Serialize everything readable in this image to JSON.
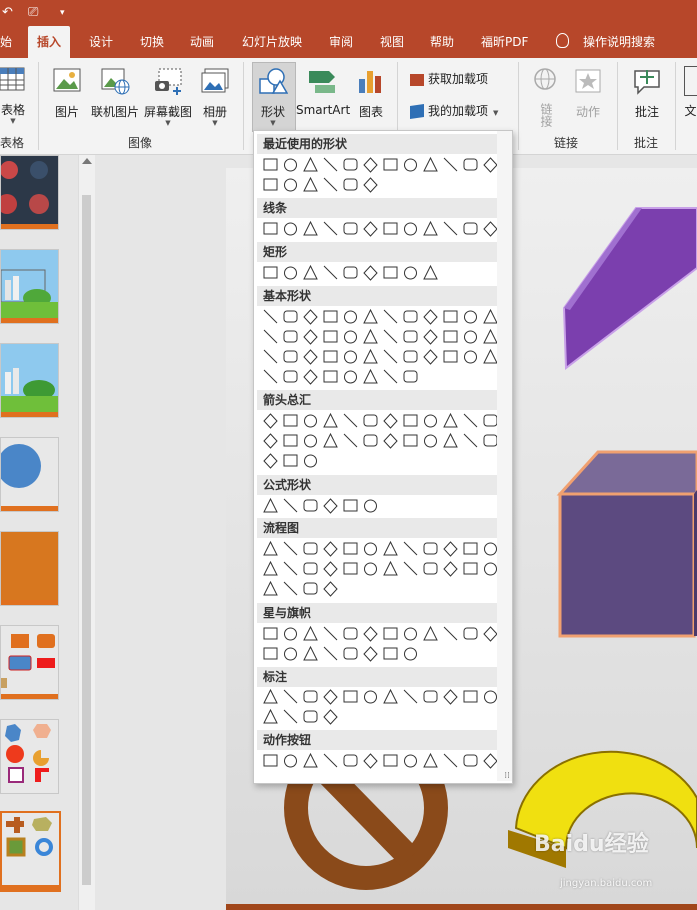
{
  "colors": {
    "accent": "#b7472a",
    "ribbon_bg": "#f3f3f3",
    "slide_bar": "#e0701f"
  },
  "tabs": [
    {
      "label": "始"
    },
    {
      "label": "插入",
      "active": true
    },
    {
      "label": "设计"
    },
    {
      "label": "切换"
    },
    {
      "label": "动画"
    },
    {
      "label": "幻灯片放映"
    },
    {
      "label": "审阅"
    },
    {
      "label": "视图"
    },
    {
      "label": "帮助"
    },
    {
      "label": "福昕PDF"
    }
  ],
  "search": {
    "label": "操作说明搜索"
  },
  "ribbon": {
    "table": {
      "label": "表格"
    },
    "picture": {
      "label": "图片"
    },
    "online_picture": {
      "label": "联机图片"
    },
    "screenshot": {
      "label": "屏幕截图"
    },
    "album": {
      "label": "相册"
    },
    "shapes": {
      "label": "形状"
    },
    "smartart": {
      "label": "SmartArt"
    },
    "chart": {
      "label": "图表"
    },
    "get_addins": {
      "label": "获取加载项"
    },
    "my_addins": {
      "label": "我的加载项"
    },
    "link": {
      "label": "链接"
    },
    "action": {
      "label": "动作"
    },
    "comment": {
      "label": "批注"
    },
    "text": {
      "label": "文"
    },
    "groups": {
      "table": "表格",
      "images": "图像",
      "links": "链接",
      "comments": "批注"
    }
  },
  "shapes_menu": {
    "sections": [
      {
        "title": "最近使用的形状"
      },
      {
        "title": "线条"
      },
      {
        "title": "矩形"
      },
      {
        "title": "基本形状"
      },
      {
        "title": "箭头总汇"
      },
      {
        "title": "公式形状"
      },
      {
        "title": "流程图"
      },
      {
        "title": "星与旗帜"
      },
      {
        "title": "标注"
      },
      {
        "title": "动作按钮"
      }
    ]
  },
  "watermark": {
    "brand": "Baidu经验",
    "url": "jingyan.baidu.com"
  }
}
